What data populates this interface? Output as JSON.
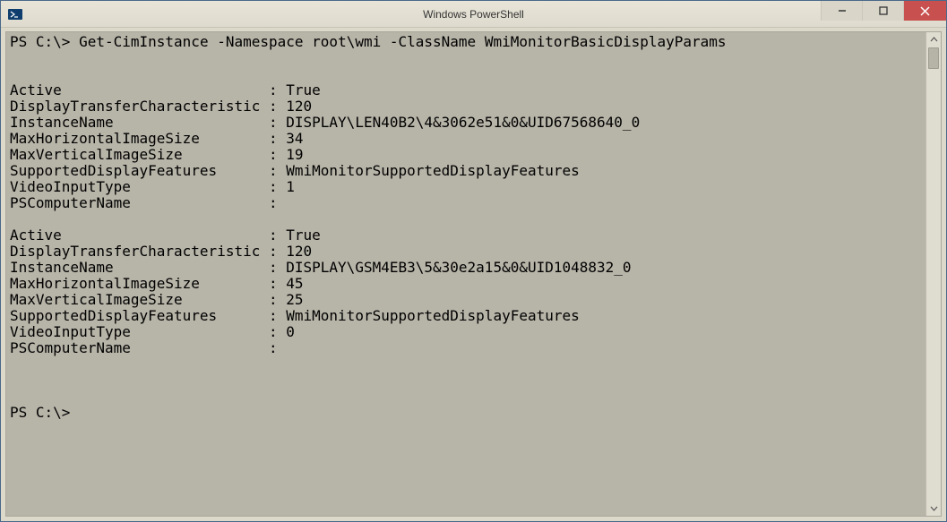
{
  "window": {
    "title": "Windows PowerShell"
  },
  "console": {
    "prompt1": "PS C:\\>",
    "command": "Get-CimInstance -Namespace root\\wmi -ClassName WmiMonitorBasicDisplayParams",
    "prompt2": "PS C:\\>",
    "records": [
      {
        "Active": "True",
        "DisplayTransferCharacteristic": "120",
        "InstanceName": "DISPLAY\\LEN40B2\\4&3062e51&0&UID67568640_0",
        "MaxHorizontalImageSize": "34",
        "MaxVerticalImageSize": "19",
        "SupportedDisplayFeatures": "WmiMonitorSupportedDisplayFeatures",
        "VideoInputType": "1",
        "PSComputerName": ""
      },
      {
        "Active": "True",
        "DisplayTransferCharacteristic": "120",
        "InstanceName": "DISPLAY\\GSM4EB3\\5&30e2a15&0&UID1048832_0",
        "MaxHorizontalImageSize": "45",
        "MaxVerticalImageSize": "25",
        "SupportedDisplayFeatures": "WmiMonitorSupportedDisplayFeatures",
        "VideoInputType": "0",
        "PSComputerName": ""
      }
    ],
    "labels": {
      "Active": "Active",
      "DisplayTransferCharacteristic": "DisplayTransferCharacteristic",
      "InstanceName": "InstanceName",
      "MaxHorizontalImageSize": "MaxHorizontalImageSize",
      "MaxVerticalImageSize": "MaxVerticalImageSize",
      "SupportedDisplayFeatures": "SupportedDisplayFeatures",
      "VideoInputType": "VideoInputType",
      "PSComputerName": "PSComputerName"
    }
  }
}
